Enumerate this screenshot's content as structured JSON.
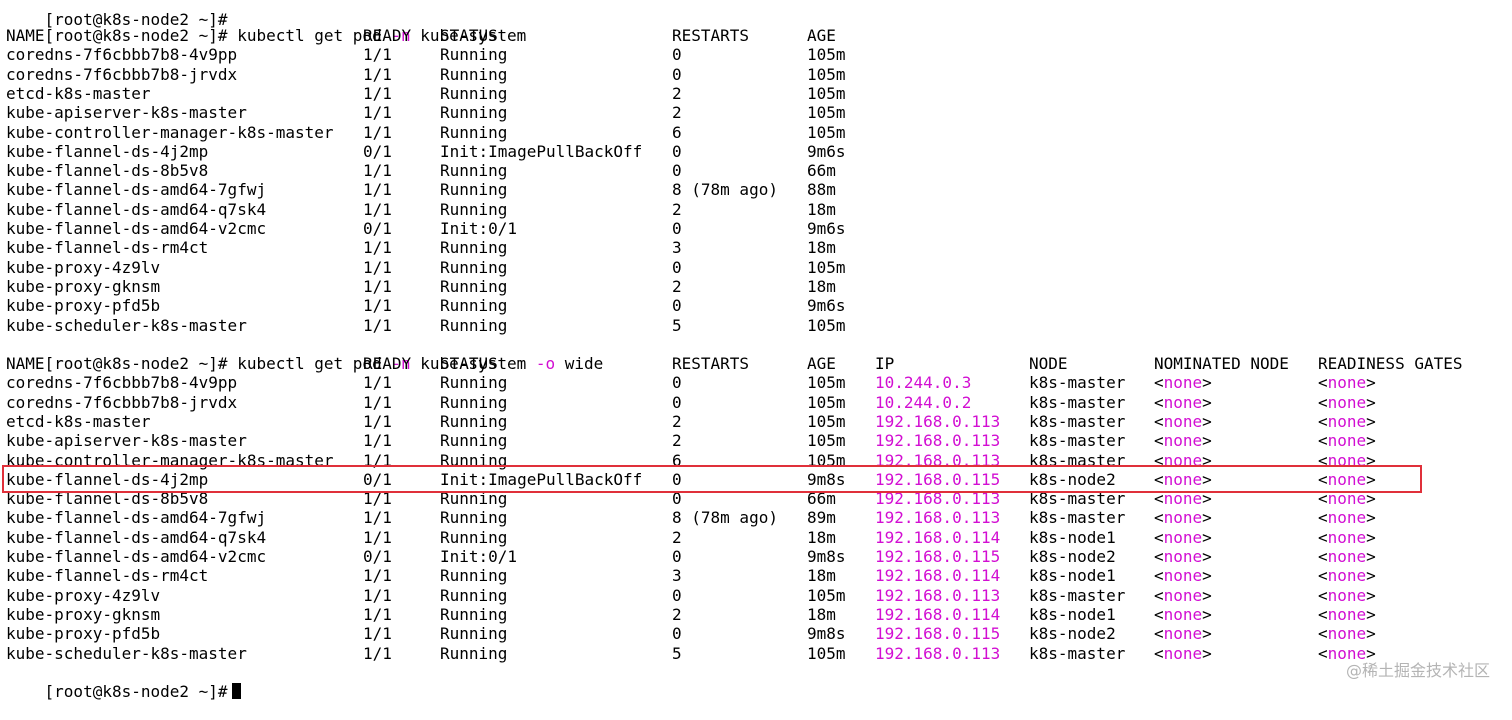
{
  "partial_top": "[root@k8s-node2 ~]#",
  "colors": {
    "flag": "#d20ed2",
    "ip": "#d20ed2",
    "highlight": "#e0303a",
    "cursor": "#000000"
  },
  "cmd1": {
    "prompt": "[root@k8s-node2 ~]#",
    "pre": "kubectl get pod",
    "flag": "-n",
    "post": "kube-system"
  },
  "table1": {
    "headers": [
      "NAME",
      "READY",
      "STATUS",
      "RESTARTS",
      "AGE"
    ],
    "rows": [
      [
        "coredns-7f6cbbb7b8-4v9pp",
        "1/1",
        "Running",
        "0",
        "105m"
      ],
      [
        "coredns-7f6cbbb7b8-jrvdx",
        "1/1",
        "Running",
        "0",
        "105m"
      ],
      [
        "etcd-k8s-master",
        "1/1",
        "Running",
        "2",
        "105m"
      ],
      [
        "kube-apiserver-k8s-master",
        "1/1",
        "Running",
        "2",
        "105m"
      ],
      [
        "kube-controller-manager-k8s-master",
        "1/1",
        "Running",
        "6",
        "105m"
      ],
      [
        "kube-flannel-ds-4j2mp",
        "0/1",
        "Init:ImagePullBackOff",
        "0",
        "9m6s"
      ],
      [
        "kube-flannel-ds-8b5v8",
        "1/1",
        "Running",
        "0",
        "66m"
      ],
      [
        "kube-flannel-ds-amd64-7gfwj",
        "1/1",
        "Running",
        "8 (78m ago)",
        "88m"
      ],
      [
        "kube-flannel-ds-amd64-q7sk4",
        "1/1",
        "Running",
        "2",
        "18m"
      ],
      [
        "kube-flannel-ds-amd64-v2cmc",
        "0/1",
        "Init:0/1",
        "0",
        "9m6s"
      ],
      [
        "kube-flannel-ds-rm4ct",
        "1/1",
        "Running",
        "3",
        "18m"
      ],
      [
        "kube-proxy-4z9lv",
        "1/1",
        "Running",
        "0",
        "105m"
      ],
      [
        "kube-proxy-gknsm",
        "1/1",
        "Running",
        "2",
        "18m"
      ],
      [
        "kube-proxy-pfd5b",
        "1/1",
        "Running",
        "0",
        "9m6s"
      ],
      [
        "kube-scheduler-k8s-master",
        "1/1",
        "Running",
        "5",
        "105m"
      ]
    ]
  },
  "cmd2": {
    "prompt": "[root@k8s-node2 ~]#",
    "pre": "kubectl get pod",
    "flag": "-n",
    "mid": "kube-system",
    "flag2": "-o",
    "post": "wide"
  },
  "table2": {
    "headers": [
      "NAME",
      "READY",
      "STATUS",
      "RESTARTS",
      "AGE",
      "IP",
      "NODE",
      "NOMINATED NODE",
      "READINESS GATES"
    ],
    "none_value": "none",
    "rows": [
      [
        "coredns-7f6cbbb7b8-4v9pp",
        "1/1",
        "Running",
        "0",
        "105m",
        "10.244.0.3",
        "k8s-master"
      ],
      [
        "coredns-7f6cbbb7b8-jrvdx",
        "1/1",
        "Running",
        "0",
        "105m",
        "10.244.0.2",
        "k8s-master"
      ],
      [
        "etcd-k8s-master",
        "1/1",
        "Running",
        "2",
        "105m",
        "192.168.0.113",
        "k8s-master"
      ],
      [
        "kube-apiserver-k8s-master",
        "1/1",
        "Running",
        "2",
        "105m",
        "192.168.0.113",
        "k8s-master"
      ],
      [
        "kube-controller-manager-k8s-master",
        "1/1",
        "Running",
        "6",
        "105m",
        "192.168.0.113",
        "k8s-master"
      ],
      [
        "kube-flannel-ds-4j2mp",
        "0/1",
        "Init:ImagePullBackOff",
        "0",
        "9m8s",
        "192.168.0.115",
        "k8s-node2"
      ],
      [
        "kube-flannel-ds-8b5v8",
        "1/1",
        "Running",
        "0",
        "66m",
        "192.168.0.113",
        "k8s-master"
      ],
      [
        "kube-flannel-ds-amd64-7gfwj",
        "1/1",
        "Running",
        "8 (78m ago)",
        "89m",
        "192.168.0.113",
        "k8s-master"
      ],
      [
        "kube-flannel-ds-amd64-q7sk4",
        "1/1",
        "Running",
        "2",
        "18m",
        "192.168.0.114",
        "k8s-node1"
      ],
      [
        "kube-flannel-ds-amd64-v2cmc",
        "0/1",
        "Init:0/1",
        "0",
        "9m8s",
        "192.168.0.115",
        "k8s-node2"
      ],
      [
        "kube-flannel-ds-rm4ct",
        "1/1",
        "Running",
        "3",
        "18m",
        "192.168.0.114",
        "k8s-node1"
      ],
      [
        "kube-proxy-4z9lv",
        "1/1",
        "Running",
        "0",
        "105m",
        "192.168.0.113",
        "k8s-master"
      ],
      [
        "kube-proxy-gknsm",
        "1/1",
        "Running",
        "2",
        "18m",
        "192.168.0.114",
        "k8s-node1"
      ],
      [
        "kube-proxy-pfd5b",
        "1/1",
        "Running",
        "0",
        "9m8s",
        "192.168.0.115",
        "k8s-node2"
      ],
      [
        "kube-scheduler-k8s-master",
        "1/1",
        "Running",
        "5",
        "105m",
        "192.168.0.113",
        "k8s-master"
      ]
    ]
  },
  "final_prompt": "[root@k8s-node2 ~]#",
  "watermark": "@稀土掘金技术社区"
}
